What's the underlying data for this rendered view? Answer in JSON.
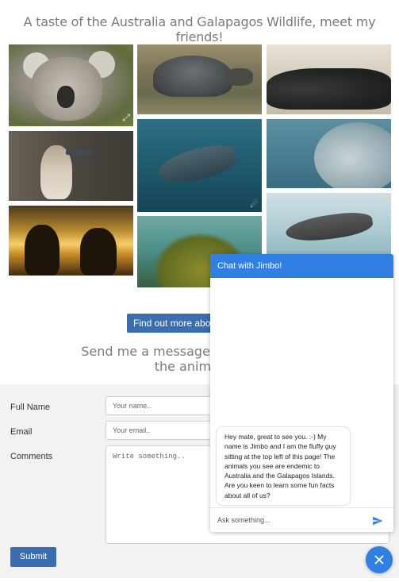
{
  "page": {
    "title": "A taste of the Australia and Galapagos Wildlife, meet my friends!",
    "find_out_button": "Find out more abo",
    "send_heading_line1": "Send me a message or use the chat l",
    "send_heading_line2": "the animals in"
  },
  "gallery": {
    "photos": [
      {
        "name": "koala"
      },
      {
        "name": "giant-tortoise"
      },
      {
        "name": "marine-iguana"
      },
      {
        "name": "blue-footed-booby"
      },
      {
        "name": "whale-shark"
      },
      {
        "name": "manta-ray"
      },
      {
        "name": "sea-lions-sunset"
      },
      {
        "name": "leafy-sea-dragon"
      },
      {
        "name": "reef-shark"
      }
    ]
  },
  "form": {
    "full_name_label": "Full Name",
    "full_name_placeholder": "Your name..",
    "email_label": "Email",
    "email_placeholder": "Your email..",
    "comments_label": "Comments",
    "comments_placeholder": "Write something..",
    "submit_label": "Submit"
  },
  "chat": {
    "header": "Chat with Jimbo!",
    "message": "Hey mate, great to see you. :-) My name is Jimbo and I am the fluffy guy sitting at the top left of this page! The animals you see are endemic to Australia and the Galapagos Islands. Are you keen to learn some fun facts about all of us?",
    "input_placeholder": "Ask something...",
    "accent_color": "#2f7fe4"
  },
  "colors": {
    "button_blue": "#3b6db0",
    "heading_grey": "#7a7a7a"
  }
}
